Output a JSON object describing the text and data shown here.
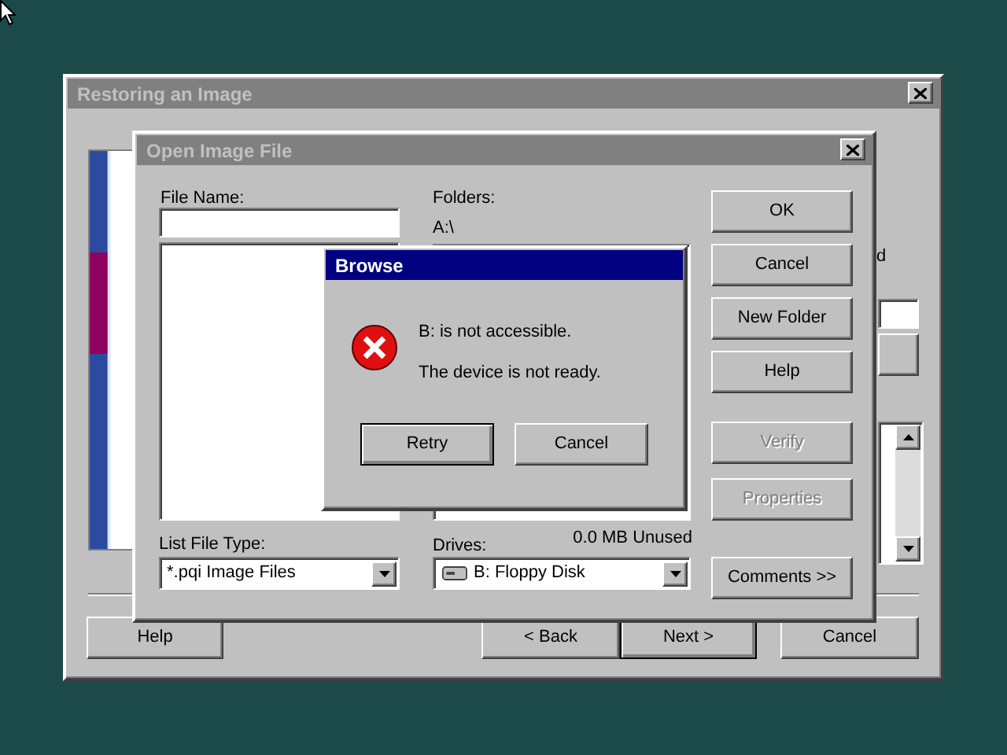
{
  "restore_window": {
    "title": "Restoring an Image",
    "active": false,
    "partial_label": "d",
    "buttons": [
      {
        "label": "Help",
        "default": false
      },
      {
        "label": "< Back",
        "default": false
      },
      {
        "label": "Next >",
        "default": true
      },
      {
        "label": "Cancel",
        "default": false
      }
    ]
  },
  "open_dialog": {
    "title": "Open Image File",
    "active": false,
    "file_name": {
      "label": "File Name:"
    },
    "folders": {
      "label": "Folders:",
      "path": "A:\\"
    },
    "list_file_type": {
      "label": "List File Type:",
      "value": "*.pqi  Image Files"
    },
    "drives": {
      "label": "Drives:",
      "value": "B:  Floppy Disk",
      "free_space": "0.0 MB Unused"
    },
    "buttons": [
      {
        "label": "OK",
        "disabled": false
      },
      {
        "label": "Cancel",
        "disabled": false
      },
      {
        "label": "New Folder",
        "disabled": false
      },
      {
        "label": "Help",
        "disabled": false
      },
      {
        "label": "Verify",
        "disabled": true
      },
      {
        "label": "Properties",
        "disabled": true
      },
      {
        "label": "Comments >>",
        "disabled": false
      }
    ]
  },
  "browse_dialog": {
    "title": "Browse",
    "active": true,
    "messages": [
      "B: is not accessible.",
      "The device is not ready."
    ],
    "buttons": [
      {
        "label": "Retry",
        "default": true
      },
      {
        "label": "Cancel",
        "default": false
      }
    ]
  }
}
